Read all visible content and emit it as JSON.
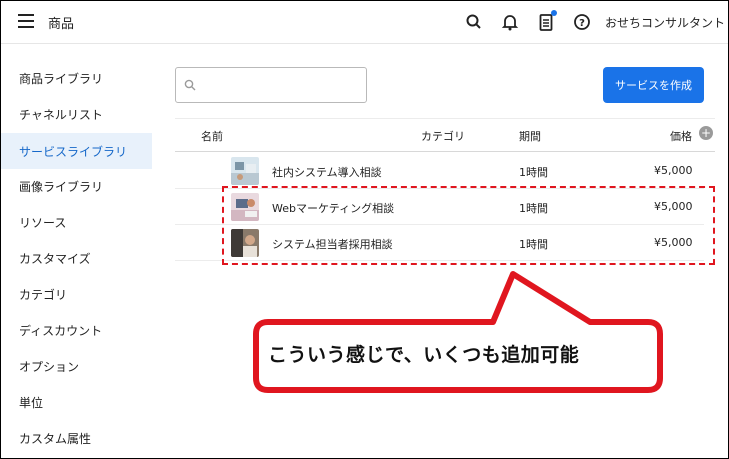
{
  "header": {
    "title": "商品",
    "user_name": "おせちコンサルタント",
    "icons": [
      "menu-icon",
      "search-icon",
      "bell-icon",
      "clipboard-icon",
      "help-icon"
    ],
    "accent_color": "#1a73e8"
  },
  "sidebar": {
    "items": [
      {
        "label": "商品ライブラリ",
        "active": false
      },
      {
        "label": "チャネルリスト",
        "active": false
      },
      {
        "label": "サービスライブラリ",
        "active": true
      },
      {
        "label": "画像ライブラリ",
        "active": false
      },
      {
        "label": "リソース",
        "active": false
      },
      {
        "label": "カスタマイズ",
        "active": false
      },
      {
        "label": "カテゴリ",
        "active": false
      },
      {
        "label": "ディスカウント",
        "active": false
      },
      {
        "label": "オプション",
        "active": false
      },
      {
        "label": "単位",
        "active": false
      },
      {
        "label": "カスタム属性",
        "active": false
      }
    ]
  },
  "main": {
    "search": {
      "value": "",
      "placeholder": ""
    },
    "create_button": "サービスを作成",
    "table": {
      "columns": [
        "名前",
        "カテゴリ",
        "期間",
        "価格"
      ],
      "rows": [
        {
          "name": "社内システム導入相談",
          "category": "",
          "duration": "1時間",
          "price": "¥5,000"
        },
        {
          "name": "Webマーケティング相談",
          "category": "",
          "duration": "1時間",
          "price": "¥5,000"
        },
        {
          "name": "システム担当者採用相談",
          "category": "",
          "duration": "1時間",
          "price": "¥5,000"
        }
      ]
    }
  },
  "annotation": {
    "text": "こういう感じで、いくつも追加可能",
    "color": "#e0161f"
  }
}
